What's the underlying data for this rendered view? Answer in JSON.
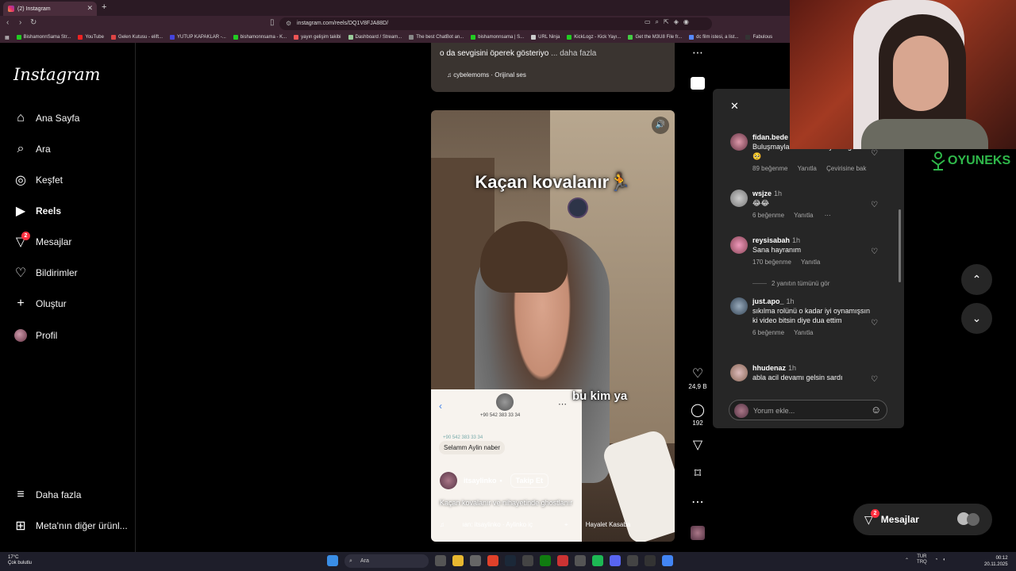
{
  "browser": {
    "tab_title": "(2) Instagram",
    "url": "instagram.com/reels/DQ1V8FJA88D/",
    "bookmarks": [
      "BishamonnSama Str...",
      "YouTube",
      "Gelen Kutusu - elift...",
      "YUTUP KAPAKLAR -...",
      "bishamonnsama - K...",
      "yayın gelişim takibi",
      "Dashboard / Stream...",
      "The best ChatBot an...",
      "bishamonnsama | S...",
      "URL Ninja",
      "KickLogz - Kick Yayı...",
      "Get the M3U8 File fr...",
      "dc film istesi, a list...",
      "Fabulous"
    ]
  },
  "sidebar": {
    "logo": "Instagram",
    "items": [
      {
        "label": "Ana Sayfa",
        "icon": "home-icon"
      },
      {
        "label": "Ara",
        "icon": "search-icon"
      },
      {
        "label": "Keşfet",
        "icon": "compass-icon"
      },
      {
        "label": "Reels",
        "icon": "reels-icon"
      },
      {
        "label": "Mesajlar",
        "icon": "messenger-icon",
        "badge": "2"
      },
      {
        "label": "Bildirimler",
        "icon": "heart-icon"
      },
      {
        "label": "Oluştur",
        "icon": "plus-icon"
      },
      {
        "label": "Profil",
        "icon": "avatar"
      }
    ],
    "more": "Daha fazla",
    "meta": "Meta'nın diğer ürünl..."
  },
  "top_reel": {
    "caption": "o da sevgisini öperek gösteriyo",
    "more": "... daha fazla",
    "audio": "cybelemoms · Orijinal ses"
  },
  "reel": {
    "overlay_title": "Kaçan kovalanır🏃",
    "subtitle": "bu kim ya",
    "chat_number": "+90 542 383 33 34",
    "chat_small": "+90 542 383 33 34",
    "chat_message": "Selamm Aylin naber",
    "username": "itsaylinko",
    "follow": "Takip Et",
    "description": "Kaçan kovalanır ve nihayetinde ghostlanır",
    "audio": "ıan: itsaylinko · Aylinko iç",
    "location": "Hayalet Kasaba"
  },
  "actions": {
    "likes": "24,9 B",
    "comments": "192"
  },
  "comments": [
    {
      "user": "fidan.bede",
      "time": "",
      "text": "Buluşmayla vaktini almayla sağ olsun🥺",
      "likes": "89 beğenme",
      "reply": "Yanıtla",
      "translate": "Çevirisine bak"
    },
    {
      "user": "wsjze",
      "time": "1h",
      "text": "😂😂",
      "likes": "6 beğenme",
      "reply": "Yanıtla",
      "translate": ""
    },
    {
      "user": "reysisabah",
      "time": "1h",
      "text": "Sana hayranım",
      "likes": "170 beğenme",
      "reply": "Yanıtla",
      "translate": ""
    },
    {
      "user": "just.apo_",
      "time": "1h",
      "text": "sıkılma rolünü o kadar iyi oynamışsın ki video bitsin diye dua ettim",
      "likes": "6 beğenme",
      "reply": "Yanıtla",
      "translate": ""
    },
    {
      "user": "hhudenaz",
      "time": "1h",
      "text": "abla acil devamı gelsin sardı",
      "likes": "",
      "reply": "",
      "translate": ""
    }
  ],
  "view_replies": "2 yanıtın tümünü gör",
  "comment_placeholder": "Yorum ekle...",
  "messages_pill": {
    "label": "Mesajlar",
    "badge": "2"
  },
  "stream_brand": "OYUNEKS",
  "taskbar": {
    "weather_temp": "17°C",
    "weather_desc": "Çok bulutlu",
    "search": "Ara",
    "lang_top": "TUR",
    "lang_bottom": "TRQ",
    "time": "00:12",
    "date": "20.11.2025"
  }
}
